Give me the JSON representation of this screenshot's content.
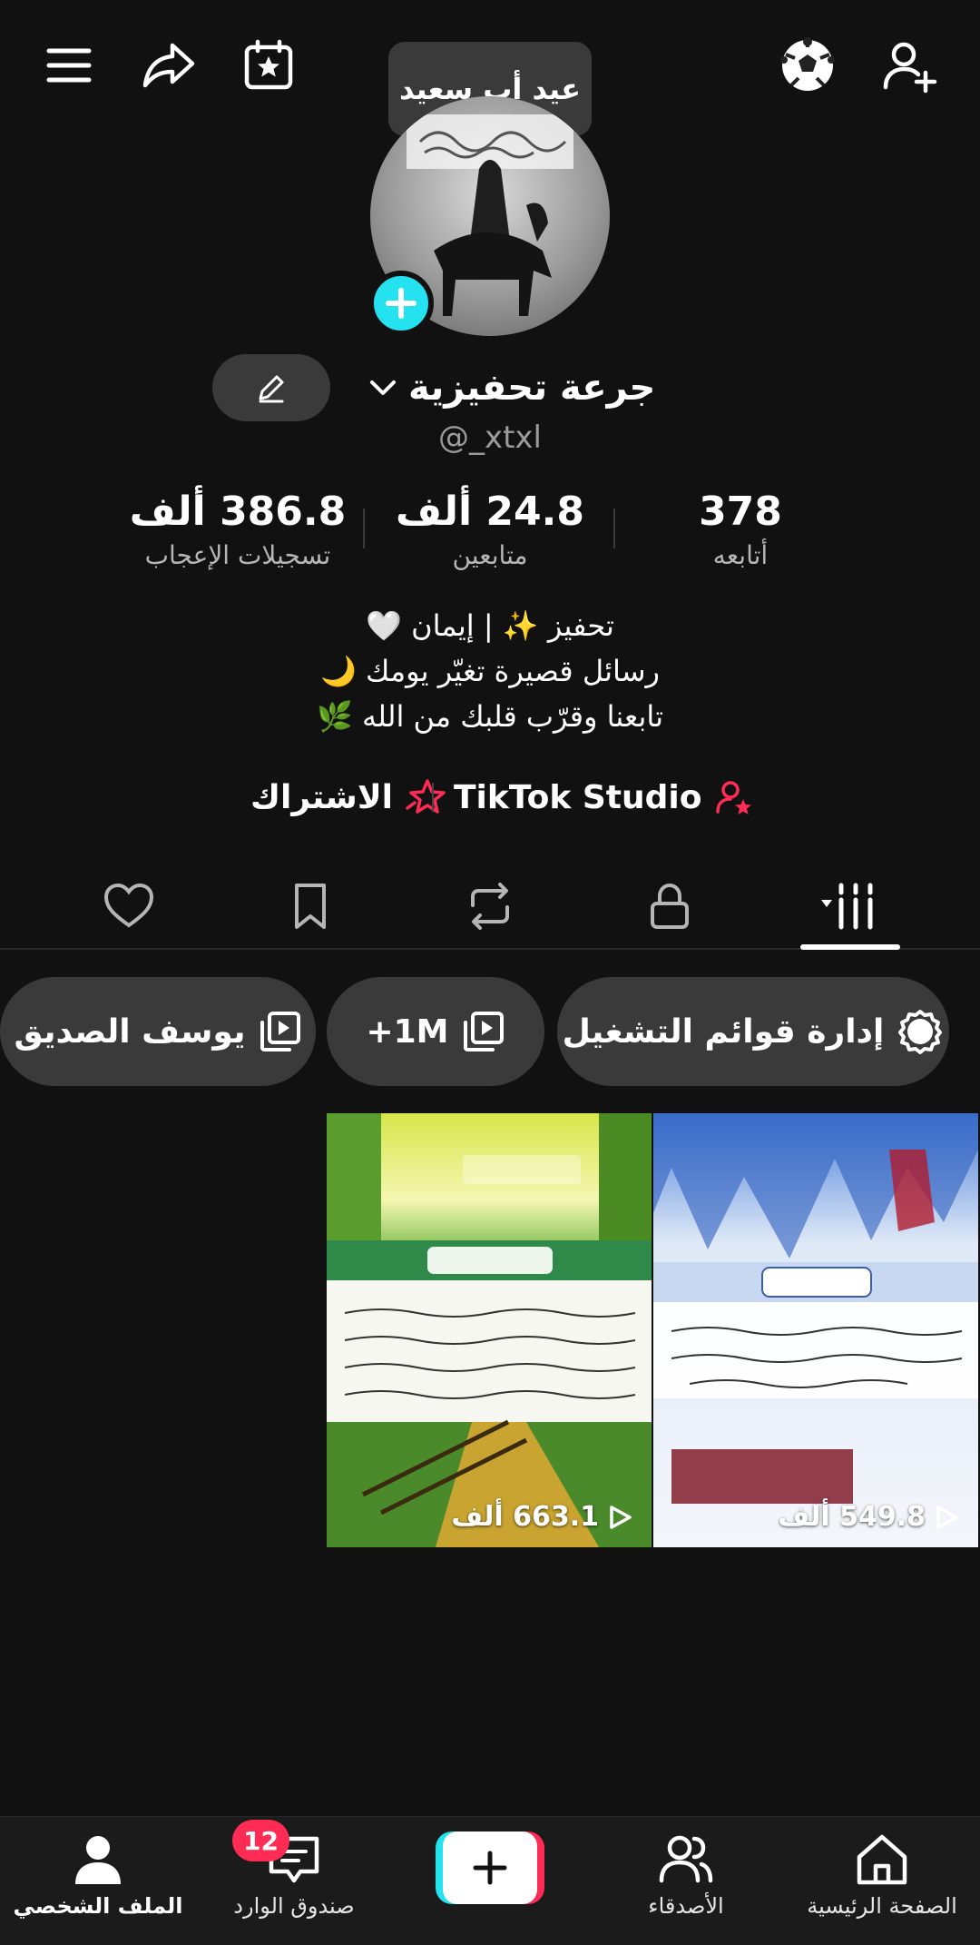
{
  "tooltip": "عيد أب سعيد",
  "profile": {
    "display_name": "جرعة تحفيزية",
    "username": "@_xtxl"
  },
  "stats": {
    "following_count": "378",
    "following_label": "أتابعه",
    "followers_count": "24.8 ألف",
    "followers_label": "متابعين",
    "likes_count": "386.8 ألف",
    "likes_label": "تسجيلات الإعجاب"
  },
  "bio": {
    "line1": "تحفيز ✨ | إيمان 🤍",
    "line2": "رسائل قصيرة تغيّر يومك 🌙",
    "line3": "تابعنا وقرّب قلبك من الله 🌿"
  },
  "links": {
    "studio": "TikTok Studio",
    "subscribe": "الاشتراك"
  },
  "playlists": {
    "manage": "إدارة قوائم التشغيل",
    "first": "+1M",
    "second": "يوسف الصديق"
  },
  "videos": [
    {
      "views": "549.8 ألف",
      "surah": "سورة الكوثر"
    },
    {
      "views": "663.1 ألف",
      "surah": "سورة الكافرون",
      "caption": "أقرب إليها سورة"
    }
  ],
  "nav": {
    "home": "الصفحة الرئيسية",
    "friends": "الأصدقاء",
    "inbox": "صندوق الوارد",
    "inbox_badge": "12",
    "profile": "الملف الشخصي"
  },
  "colors": {
    "background": "#111111",
    "accent_cyan": "#25e2f0",
    "accent_red": "#fe2c55"
  }
}
